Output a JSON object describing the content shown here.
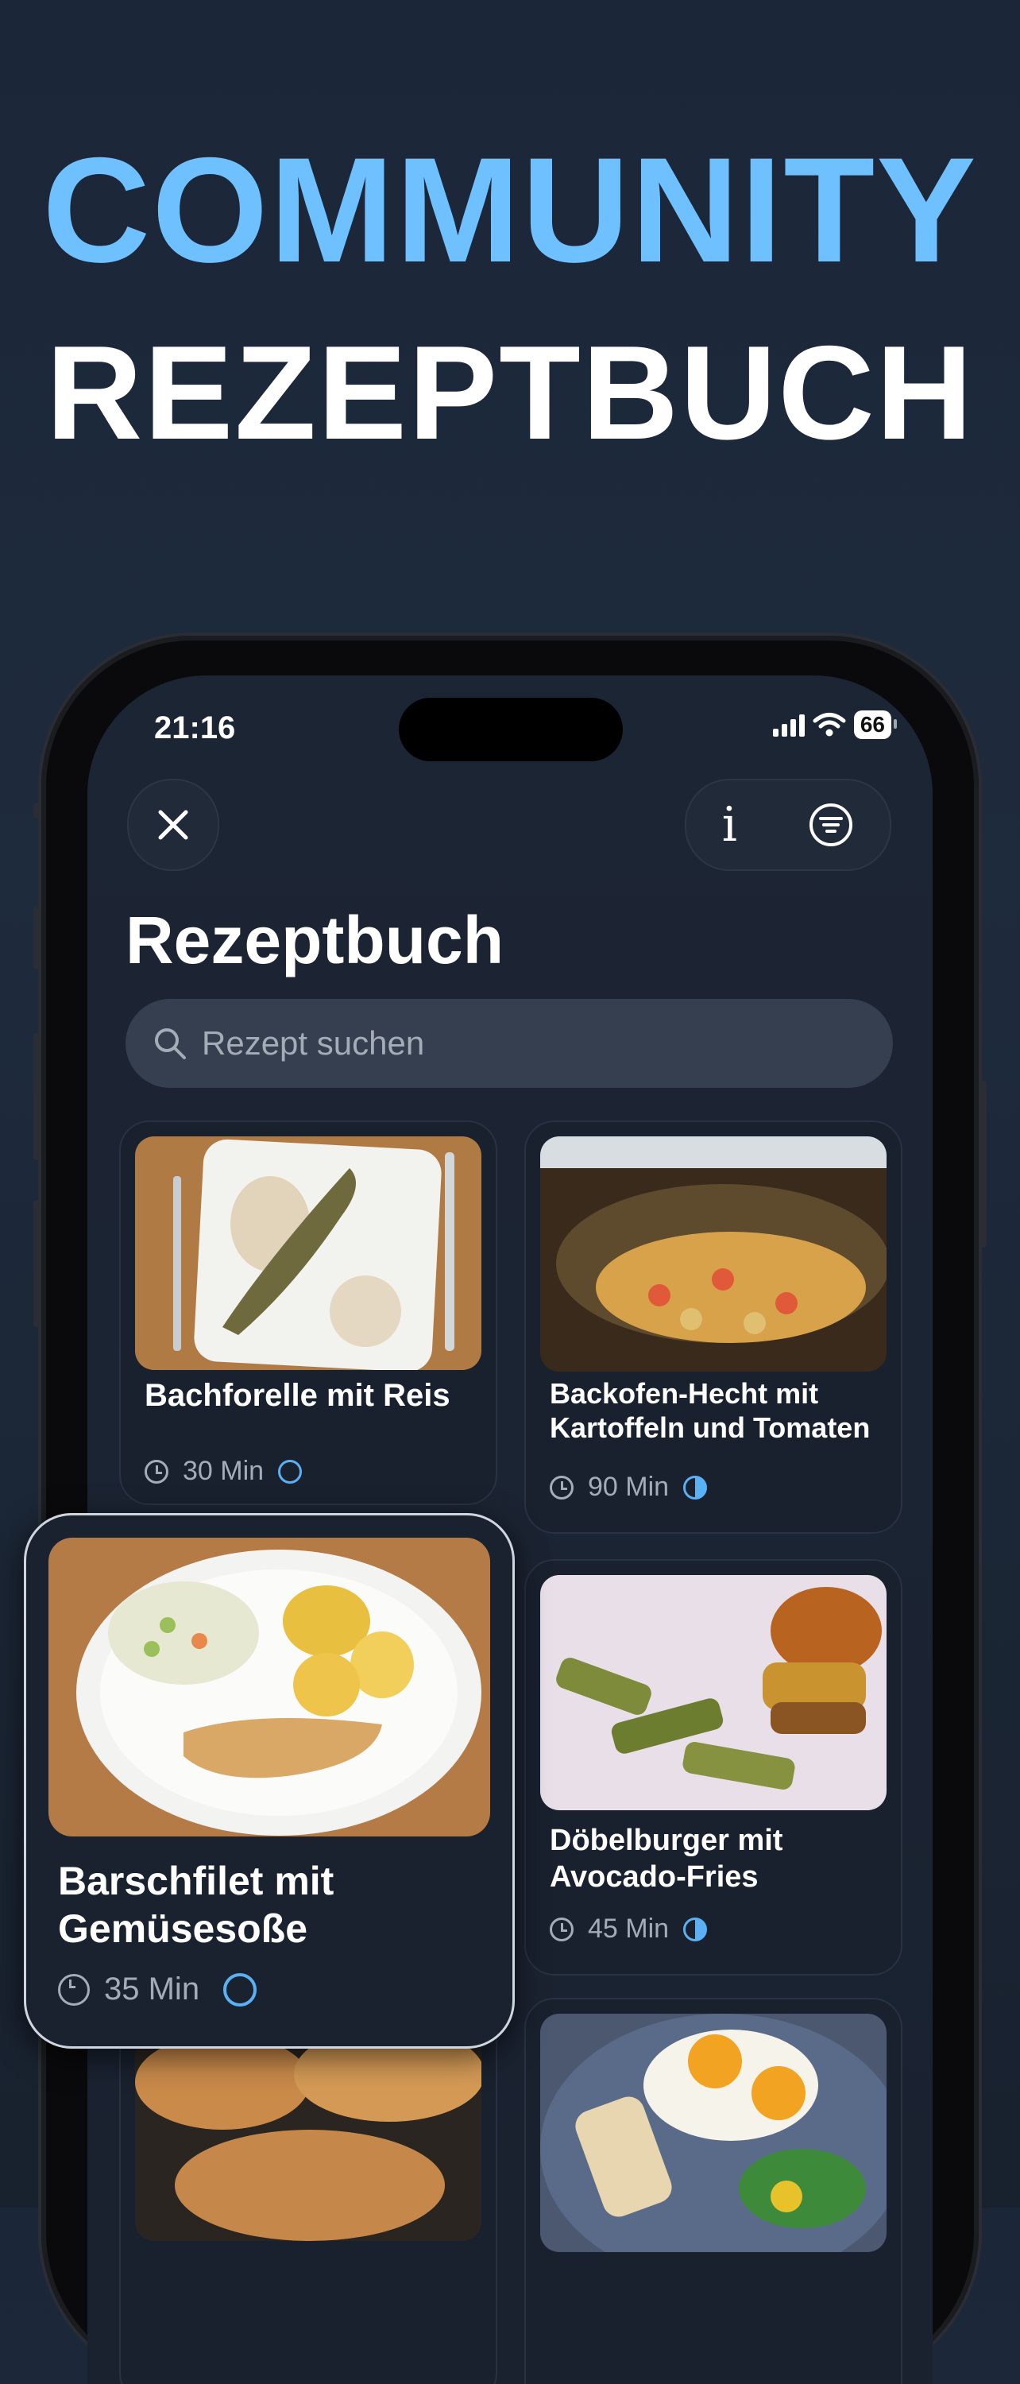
{
  "headline": {
    "line1": "COMMUNITY",
    "line2": "REZEPTBUCH"
  },
  "status_bar": {
    "time": "21:16",
    "battery": "66"
  },
  "page": {
    "title": "Rezeptbuch"
  },
  "toolbar": {
    "info_label": "i"
  },
  "search": {
    "placeholder": "Rezept suchen"
  },
  "recipes": [
    {
      "title": "Bachforelle mit Reis",
      "time": "30 Min",
      "difficulty": "easy"
    },
    {
      "title": "Backofen-Hecht mit Kartoffeln und Tomaten",
      "time": "90 Min",
      "difficulty": "medium"
    },
    {
      "title": "Barschfilet mit Gemüsesoße",
      "time": "35 Min",
      "difficulty": "easy"
    },
    {
      "title": "Döbelburger mit Avocado-Fries",
      "time": "45 Min",
      "difficulty": "medium"
    }
  ],
  "colors": {
    "accent": "#6ec0ff",
    "background": "#1b2738",
    "difficulty": "#5ab0f2"
  }
}
